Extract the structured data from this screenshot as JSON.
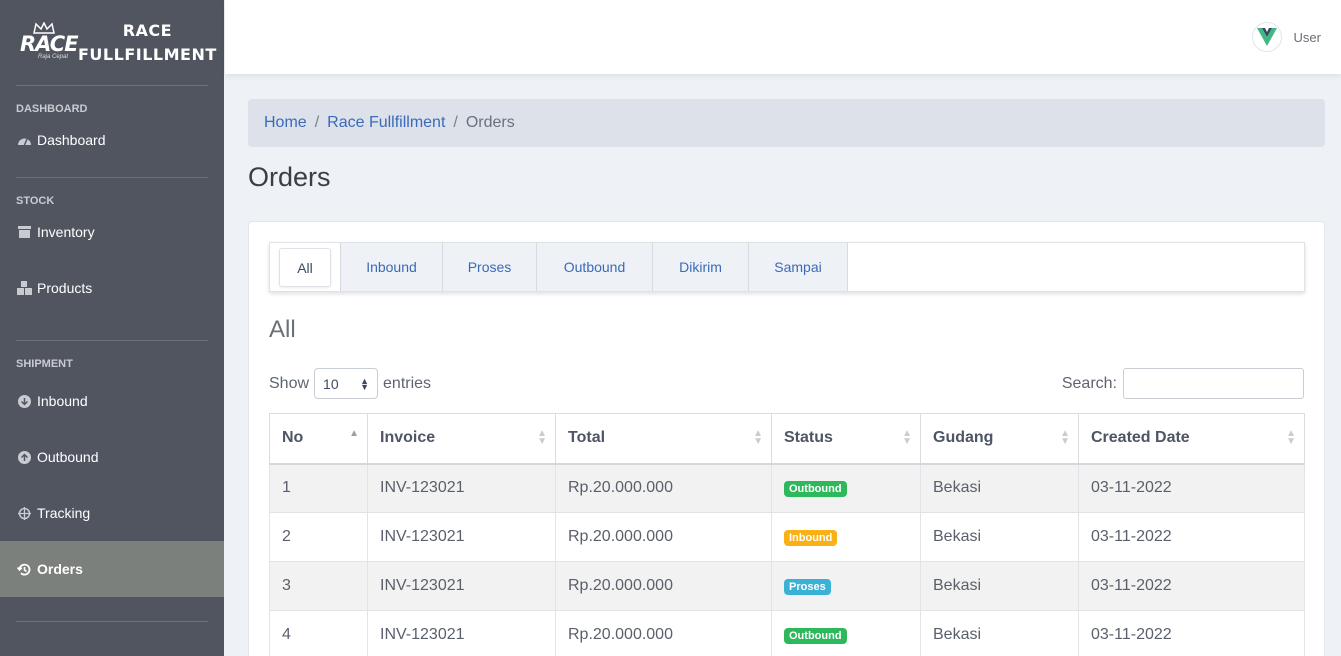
{
  "brand": {
    "logo_text": "RACE",
    "logo_tagline": "Raja Cepat",
    "name_line1": "RACE",
    "name_line2": "FULLFILLMENT"
  },
  "sidebar": {
    "sections": [
      {
        "title": "DASHBOARD",
        "items": [
          {
            "label": "Dashboard",
            "icon": "speedometer-icon"
          }
        ]
      },
      {
        "title": "STOCK",
        "items": [
          {
            "label": "Inventory",
            "icon": "archive-icon"
          },
          {
            "label": "Products",
            "icon": "boxes-icon"
          }
        ]
      },
      {
        "title": "SHIPMENT",
        "items": [
          {
            "label": "Inbound",
            "icon": "arrow-down-circle-icon"
          },
          {
            "label": "Outbound",
            "icon": "arrow-up-circle-icon"
          },
          {
            "label": "Tracking",
            "icon": "crosshair-icon"
          },
          {
            "label": "Orders",
            "icon": "history-icon",
            "active": true
          }
        ]
      }
    ]
  },
  "header": {
    "user_name": "User"
  },
  "breadcrumb": {
    "home": "Home",
    "parent": "Race Fullfillment",
    "current": "Orders",
    "separator": "/"
  },
  "page": {
    "title": "Orders",
    "section_title": "All"
  },
  "tabs": [
    "All",
    "Inbound",
    "Proses",
    "Outbound",
    "Dikirim",
    "Sampai"
  ],
  "table_controls": {
    "show_label": "Show",
    "entries_value": "10",
    "entries_label": "entries",
    "search_label": "Search:",
    "search_value": ""
  },
  "table": {
    "columns": [
      "No",
      "Invoice",
      "Total",
      "Status",
      "Gudang",
      "Created Date"
    ],
    "rows": [
      {
        "no": "1",
        "invoice": "INV-123021",
        "total": "Rp.20.000.000",
        "status": "Outbound",
        "gudang": "Bekasi",
        "date": "03-11-2022"
      },
      {
        "no": "2",
        "invoice": "INV-123021",
        "total": "Rp.20.000.000",
        "status": "Inbound",
        "gudang": "Bekasi",
        "date": "03-11-2022"
      },
      {
        "no": "3",
        "invoice": "INV-123021",
        "total": "Rp.20.000.000",
        "status": "Proses",
        "gudang": "Bekasi",
        "date": "03-11-2022"
      },
      {
        "no": "4",
        "invoice": "INV-123021",
        "total": "Rp.20.000.000",
        "status": "Outbound",
        "gudang": "Bekasi",
        "date": "03-11-2022"
      }
    ]
  },
  "colors": {
    "sidebar_bg": "#505560",
    "active_item_bg": "#7b807c",
    "link": "#3b6ab8",
    "badge_outbound": "#2eb85c",
    "badge_inbound": "#f9b115",
    "badge_proses": "#39b2d5"
  }
}
